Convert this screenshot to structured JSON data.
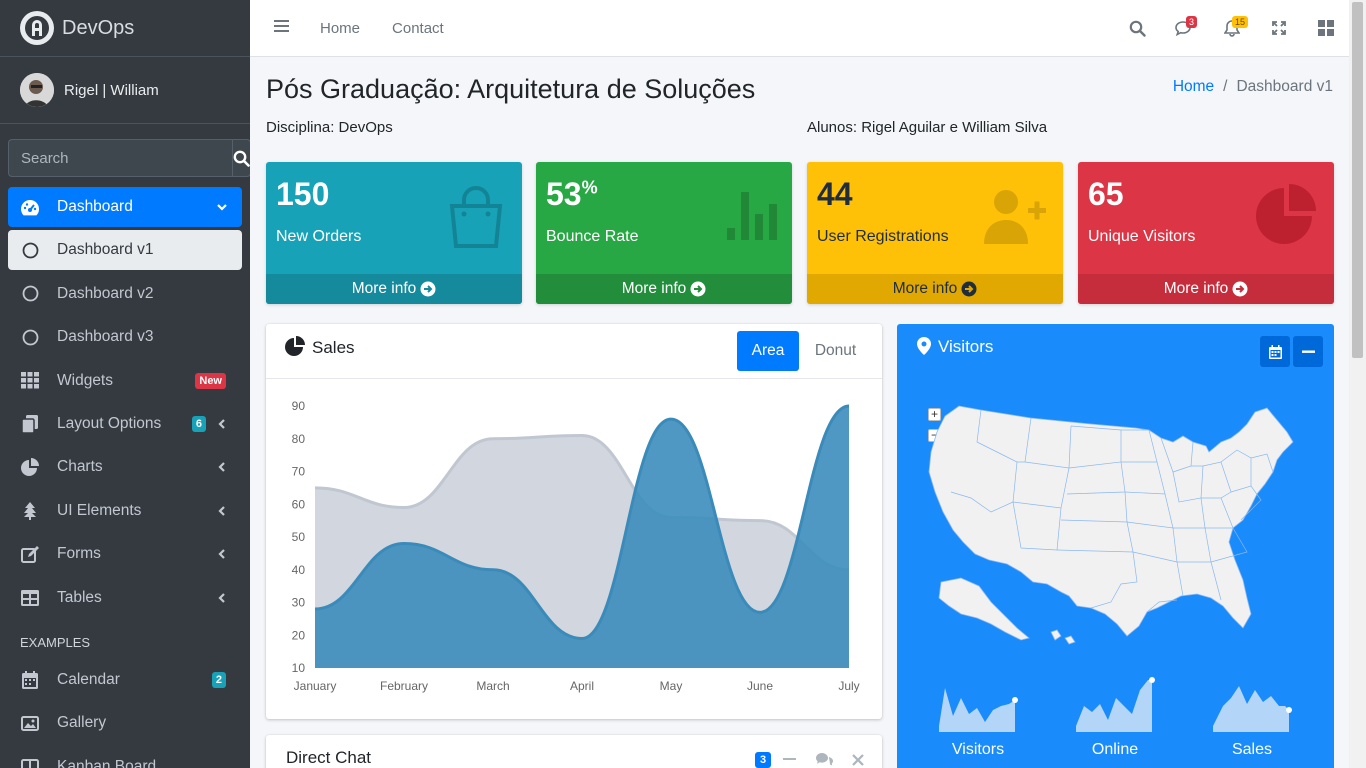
{
  "brand": {
    "name": "DevOps"
  },
  "user": {
    "name": "Rigel | William"
  },
  "search": {
    "placeholder": "Search"
  },
  "sidebar": {
    "items": [
      {
        "label": "Dashboard"
      },
      {
        "label": "Dashboard v1"
      },
      {
        "label": "Dashboard v2"
      },
      {
        "label": "Dashboard v3"
      },
      {
        "label": "Widgets",
        "badge": "New"
      },
      {
        "label": "Layout Options",
        "badge": "6"
      },
      {
        "label": "Charts"
      },
      {
        "label": "UI Elements"
      },
      {
        "label": "Forms"
      },
      {
        "label": "Tables"
      }
    ],
    "header": "EXAMPLES",
    "examples": [
      {
        "label": "Calendar",
        "badge": "2"
      },
      {
        "label": "Gallery"
      },
      {
        "label": "Kanban Board"
      }
    ]
  },
  "topnav": {
    "links": [
      "Home",
      "Contact"
    ],
    "messages_count": "3",
    "notifications_count": "15"
  },
  "page": {
    "title": "Pós Graduação: Arquitetura de Soluções",
    "breadcrumb": [
      "Home",
      "Dashboard v1"
    ],
    "discipline": "Disciplina: DevOps",
    "students": "Alunos: Rigel Aguilar e William Silva"
  },
  "stats": [
    {
      "value": "150",
      "suffix": "",
      "label": "New Orders",
      "more": "More info",
      "color": "#17a2b8"
    },
    {
      "value": "53",
      "suffix": "%",
      "label": "Bounce Rate",
      "more": "More info",
      "color": "#28a745"
    },
    {
      "value": "44",
      "suffix": "",
      "label": "User Registrations",
      "more": "More info",
      "color": "#ffc107"
    },
    {
      "value": "65",
      "suffix": "",
      "label": "Unique Visitors",
      "more": "More info",
      "color": "#dc3545"
    }
  ],
  "sales": {
    "title": "Sales",
    "tabs": [
      "Area",
      "Donut"
    ],
    "active_tab": "Area"
  },
  "visitors": {
    "title": "Visitors",
    "sparklines": [
      "Visitors",
      "Online",
      "Sales"
    ]
  },
  "chat": {
    "title": "Direct Chat",
    "badge": "3"
  },
  "chart_data": {
    "type": "area",
    "categories": [
      "January",
      "February",
      "March",
      "April",
      "May",
      "June",
      "July"
    ],
    "yticks": [
      10,
      20,
      30,
      40,
      50,
      60,
      70,
      80,
      90
    ],
    "ylim": [
      10,
      90
    ],
    "series": [
      {
        "color": "#d2d6de",
        "values": [
          65,
          59,
          80,
          81,
          56,
          55,
          40
        ]
      },
      {
        "color": "#3c8dbc",
        "values": [
          28,
          48,
          40,
          19,
          86,
          27,
          90
        ]
      }
    ]
  }
}
